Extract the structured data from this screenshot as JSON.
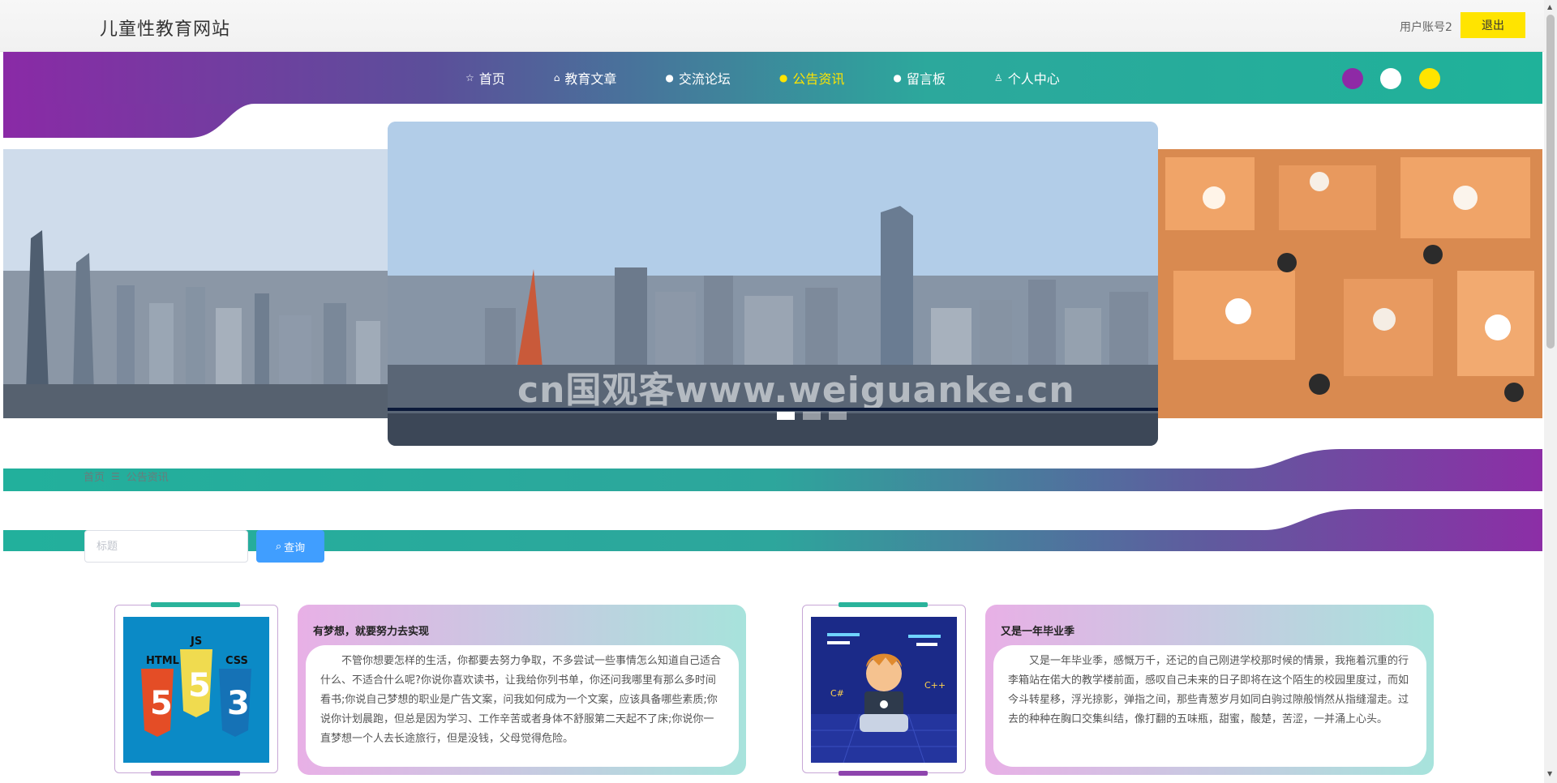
{
  "header": {
    "site_title": "儿童性教育网站",
    "account": "用户账号2",
    "logout_label": "退出"
  },
  "nav": {
    "items": [
      {
        "label": "首页",
        "icon": "star-icon"
      },
      {
        "label": "教育文章",
        "icon": "bag-icon"
      },
      {
        "label": "交流论坛",
        "icon": "info-icon"
      },
      {
        "label": "公告资讯",
        "icon": "help-icon",
        "active": true
      },
      {
        "label": "留言板",
        "icon": "info-icon"
      },
      {
        "label": "个人中心",
        "icon": "user-icon"
      }
    ],
    "theme_dots": [
      "#8e2aa6",
      "#ffffff",
      "#ffe400"
    ]
  },
  "carousel": {
    "watermark": "cn国观客www.weiguanke.cn",
    "prev_icon": "‹",
    "indicator_count": 3,
    "active_index": 0,
    "slides": [
      "city-skyline-left",
      "city-skyline-center",
      "study-hall-right"
    ]
  },
  "breadcrumb": {
    "home": "首页",
    "separator_icon": "menu-icon",
    "current": "公告资讯"
  },
  "search": {
    "placeholder": "标题",
    "value": "",
    "button_label": "查询"
  },
  "news": [
    {
      "title": "有梦想，就要努力去实现",
      "thumb": "html5-css3-js-logos",
      "body": "不管你想要怎样的生活，你都要去努力争取，不多尝试一些事情怎么知道自己适合什么、不适合什么呢?你说你喜欢读书，让我给你列书单，你还问我哪里有那么多时间看书;你说自己梦想的职业是广告文案，问我如何成为一个文案，应该具备哪些素质;你说你计划晨跑，但总是因为学习、工作辛苦或者身体不舒服第二天起不了床;你说你一直梦想一个人去长途旅行，但是没钱，父母觉得危险。"
    },
    {
      "title": "又是一年毕业季",
      "thumb": "coder-illustration",
      "body": "又是一年毕业季，感慨万千，还记的自己刚进学校那时候的情景，我拖着沉重的行李箱站在偌大的教学楼前面，感叹自己未来的日子即将在这个陌生的校园里度过，而如今斗转星移，浮光掠影，弹指之间，那些青葱岁月如同白驹过隙般悄然从指缝溜走。过去的种种在胸口交集纠结，像打翻的五味瓶，甜蜜，酸楚，苦涩，一并涌上心头。"
    }
  ],
  "colors": {
    "purple": "#8e2aa6",
    "teal": "#2ab39b",
    "yellow": "#ffe400",
    "search_button": "#409eff"
  }
}
